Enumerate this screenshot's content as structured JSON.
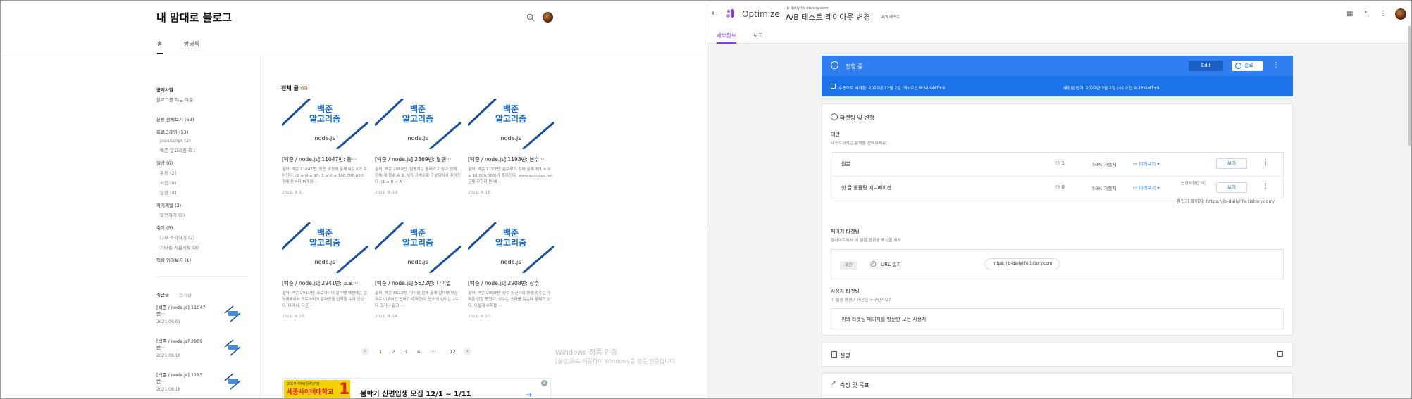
{
  "blog": {
    "title": "내 맘대로 블로그",
    "tabs": [
      "홈",
      "방명록"
    ],
    "sidebar": {
      "notice_title": "공지사항",
      "notice_item": "블로그를 하는 이유",
      "categories": [
        {
          "label": "분류 전체보기 (69)",
          "level": 0
        },
        {
          "label": "프로그래밍 (53)",
          "level": 0
        },
        {
          "label": "JavaScript (2)",
          "level": 1
        },
        {
          "label": "백준 알고리즘 (51)",
          "level": 1
        },
        {
          "label": "일상 (6)",
          "level": 0
        },
        {
          "label": "운동 (2)",
          "level": 1
        },
        {
          "label": "사진 (0)",
          "level": 1
        },
        {
          "label": "일상 (4)",
          "level": 1
        },
        {
          "label": "자기계발 (3)",
          "level": 0
        },
        {
          "label": "일면하기 (3)",
          "level": 1
        },
        {
          "label": "취미 (5)",
          "level": 0
        },
        {
          "label": "나무 조각하기 (2)",
          "level": 1
        },
        {
          "label": "기타를 처음시작 (3)",
          "level": 1
        },
        {
          "label": "책을 읽어보자 (1)",
          "level": 0
        }
      ],
      "recent_tabs": [
        "최근글",
        "인기글"
      ],
      "recent": [
        {
          "title": "[백준 / node.js] 11047번···",
          "date": "2021.09.01"
        },
        {
          "title": "[백준 / node.js] 2869번···",
          "date": "2021.08.19"
        },
        {
          "title": "[백준 / node.js] 1193번···",
          "date": "2021.08.18"
        }
      ]
    },
    "main": {
      "heading": "전체 글",
      "count": "69",
      "thumb_line1": "백준",
      "thumb_line2": "알고리즘",
      "thumb_sub": "node.js",
      "posts": [
        {
          "title": "[백준 / node.js] 11047번: 동···",
          "excerpt": "출처: 백준 11047번: 동전 0 정해 출제 N은 K가 주어진다. (1 ≤ N ≤ 10, 1 ≤ K ≤ 100,000,000) 정해 동부터 M개의 ···",
          "date": "2021. 9. 1."
        },
        {
          "title": "[백준 / node.js] 2869번: 달팽···",
          "excerpt": "출처: 백준 2869번: 달팽이는 올라가고 싶다 정해 정해 세 정수 A, B, V가 공백으로 구분되어서 주어진다. (1 ≤ B < A ···",
          "date": "2021. 8. 19."
        },
        {
          "title": "[백준 / node.js] 1193번: 분수···",
          "excerpt": "출처: 백준 1193번: 분수찾기 정해 출제 X(1 ≤ X ≤ 10,000,000)가 주어진다. www.acmicpc.net 문제 무한히 큰 배···",
          "date": "2021. 8. 18."
        },
        {
          "title": "[백준 / node.js] 2941번: 크로···",
          "excerpt": "출처: 백준 2941번: 크로아티아 알파벳 예전에는 운영체제에서 크로아티아 알파벳을 입력할 수가 없었다. 따라서, 다음···",
          "date": "2021. 8. 15."
        },
        {
          "title": "[백준 / node.js] 5622번: 다이얼",
          "excerpt": "출처: 백준 5622번: 다이얼 정해 출제 알파벳 대문자로 이루어진 단어가 주어진다. 단어의 길이는 2보다 크거나 같고, ···",
          "date": "2021. 8. 14."
        },
        {
          "title": "[백준 / node.js] 2908번: 상수",
          "excerpt": "출처: 백준 2908번: 상수 상근이의 동생 상수는 수학을 정말 못한다. 상수는 숫자를 읽는데 문제가 있다. 이렇게 수학을 ···",
          "date": "2021. 8. 13."
        }
      ],
      "pagination": {
        "prev": "‹",
        "pages": [
          "1",
          "2",
          "3",
          "4",
          "···",
          "12"
        ],
        "current": "1",
        "next": "›"
      }
    },
    "watermark": {
      "line1": "Windows 정품 인증",
      "line2": "[설정]으로 이동하여 Windows를 정품 인증합니다."
    },
    "ad": {
      "image_top": "교육부 위탁(원격)기관",
      "image_brand": "세종사이버대학교",
      "image_num": "1",
      "text": "봄학기 신편입생 모집 12/1 ~ 1/11",
      "arrow": "→",
      "close": "✕"
    }
  },
  "optimize": {
    "brand": "Optimize",
    "site_url": "jb-dailylife.tistory.com",
    "experiment_title": "A/B 테스트 레이아웃 변경",
    "experiment_type": "A/B 테스트",
    "tabs": [
      "세부정보",
      "보고"
    ],
    "status": {
      "label": "진행 중",
      "edit": "Edit",
      "end": "종료",
      "started": "수동으로 시작함: 2021년 12월 2일 (목) 오전 9:36 GMT+9",
      "planned_end": "예정된 만기: 2022년 3월 2일 (수) 오전 9:36 GMT+9"
    },
    "targeting": {
      "heading": "타겟팅 및 변형",
      "variants_label": "대안",
      "variants_hint": "테스트하려는 항목을 선택하세요.",
      "variants": [
        {
          "name": "원본",
          "users": "1",
          "weight": "50% 가중치",
          "preview": "미리보기",
          "status": "",
          "view": "보기"
        },
        {
          "name": "첫 글 롤플링 애니메이션",
          "users": "0",
          "weight": "50% 가중치",
          "preview": "미리보기",
          "status": "변경사항급 개)",
          "view": "보기"
        }
      ],
      "editor_page": "편집기 페이지: https://jb-dailylife.tistory.com/",
      "page_label": "페이지 타겟팅",
      "page_hint": "웹사이트에서 이 실험 환경을 표시할 위치",
      "rule_tag": "조건",
      "rule_match": "URL 일치",
      "rule_value": "https://jb-dailylife.tistory.com",
      "audience_label": "사용자 타겟팅",
      "audience_hint": "이 실험 환경의 대상은 누구인가요?",
      "audience_value": "위의 타겟팅 페이지를 방문한 모든 사용자"
    },
    "description_heading": "설명",
    "measure_heading": "측정 및 목표"
  },
  "colors": {
    "accent": "#1a73e8",
    "purple": "#7b3fe4",
    "orange": "#e8691f"
  }
}
